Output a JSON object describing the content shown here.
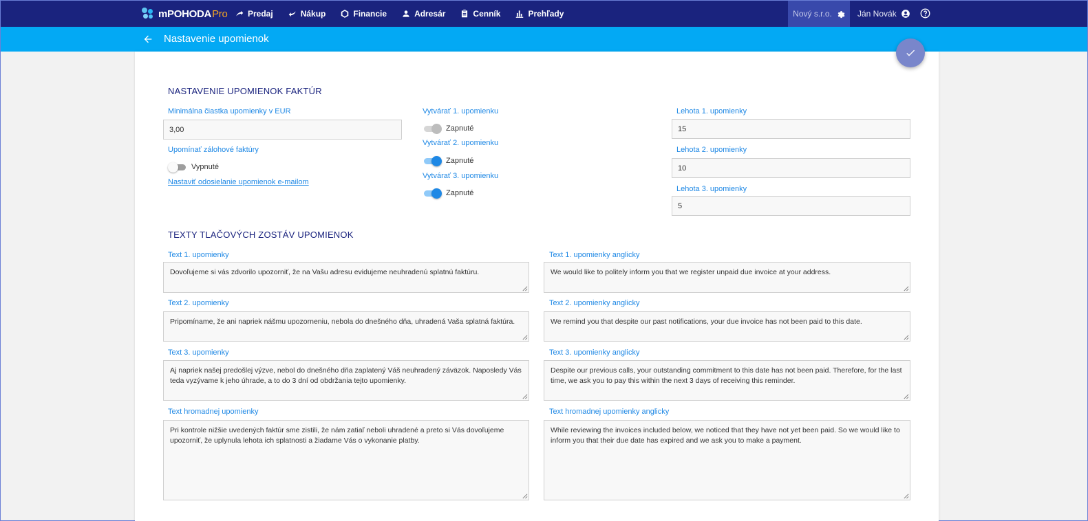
{
  "app": {
    "name": "mPOHODA",
    "edition": "Pro"
  },
  "nav": [
    {
      "label": "Predaj",
      "icon": "sales-icon"
    },
    {
      "label": "Nákup",
      "icon": "purchase-icon"
    },
    {
      "label": "Financie",
      "icon": "finance-icon"
    },
    {
      "label": "Adresár",
      "icon": "person-icon"
    },
    {
      "label": "Cenník",
      "icon": "pricelist-icon"
    },
    {
      "label": "Prehľady",
      "icon": "bar-chart-icon"
    }
  ],
  "company": {
    "name": "Nový s.r.o.",
    "icon": "gear-icon"
  },
  "user": {
    "name": "Ján Novák",
    "icon": "account-circle-icon"
  },
  "help_icon": "help-circle-icon",
  "subheader": {
    "title": "Nastavenie upomienok",
    "back_icon": "arrow-left-icon"
  },
  "save_icon": "check-icon",
  "settings": {
    "title": "NASTAVENIE UPOMIENOK FAKTÚR",
    "min_amount": {
      "label": "Minimálna čiastka upomienky v EUR",
      "value": "3,00"
    },
    "deposit": {
      "label": "Upomínať zálohové faktúry",
      "state": "Vypnuté"
    },
    "email_link": "Nastaviť odosielanie upomienok e-mailom",
    "create1": {
      "label": "Vytvárať 1. upomienku",
      "state": "Zapnuté"
    },
    "create2": {
      "label": "Vytvárať 2. upomienku",
      "state": "Zapnuté"
    },
    "create3": {
      "label": "Vytvárať 3. upomienku",
      "state": "Zapnuté"
    },
    "deadline1": {
      "label": "Lehota 1. upomienky",
      "value": "15"
    },
    "deadline2": {
      "label": "Lehota 2. upomienky",
      "value": "10"
    },
    "deadline3": {
      "label": "Lehota 3. upomienky",
      "value": "5"
    }
  },
  "texts": {
    "title": "TEXTY TLAČOVÝCH ZOSTÁV UPOMIENOK",
    "t1": {
      "label": "Text 1. upomienky",
      "value": "Dovoľujeme si vás zdvorilo upozorniť, že na Vašu adresu evidujeme neuhradenú splatnú faktúru."
    },
    "t1en": {
      "label": "Text 1. upomienky anglicky",
      "value": "We would like to politely inform you that we register unpaid due invoice at your address."
    },
    "t2": {
      "label": "Text 2. upomienky",
      "value": "Pripomíname, že ani napriek nášmu upozorneniu, nebola do dnešného dňa, uhradená Vaša splatná faktúra."
    },
    "t2en": {
      "label": "Text 2. upomienky anglicky",
      "value": "We remind you that despite our past notifications, your due invoice has not been paid to this date."
    },
    "t3": {
      "label": "Text 3. upomienky",
      "value": "Aj napriek našej predošlej výzve, nebol do dnešného dňa zaplatený Váš neuhradený záväzok. Naposledy Vás teda vyzývame k jeho úhrade, a to do 3 dní od obdržania tejto upomienky."
    },
    "t3en": {
      "label": "Text 3. upomienky anglicky",
      "value": "Despite our previous calls, your outstanding commitment to this date has not been paid. Therefore, for the last time, we ask you to pay this within the next 3 days of receiving this reminder."
    },
    "tb": {
      "label": "Text hromadnej upomienky",
      "value": "Pri kontrole nižšie uvedených faktúr sme zistili, že nám zatiaľ neboli uhradené a preto si Vás dovoľujeme upozorniť, že uplynula lehota ich splatnosti a žiadame Vás o vykonanie platby."
    },
    "tben": {
      "label": "Text hromadnej upomienky anglicky",
      "value": "While reviewing the invoices included below, we noticed that they have not yet been paid. So we would like to inform you that their due date has expired and we ask you to make a payment."
    }
  },
  "colors": {
    "topbar": "#1a237e",
    "subbar": "#03a9f4",
    "accent": "#1e88e5",
    "fab": "#7986cb",
    "brand_pro": "#f5a623"
  }
}
